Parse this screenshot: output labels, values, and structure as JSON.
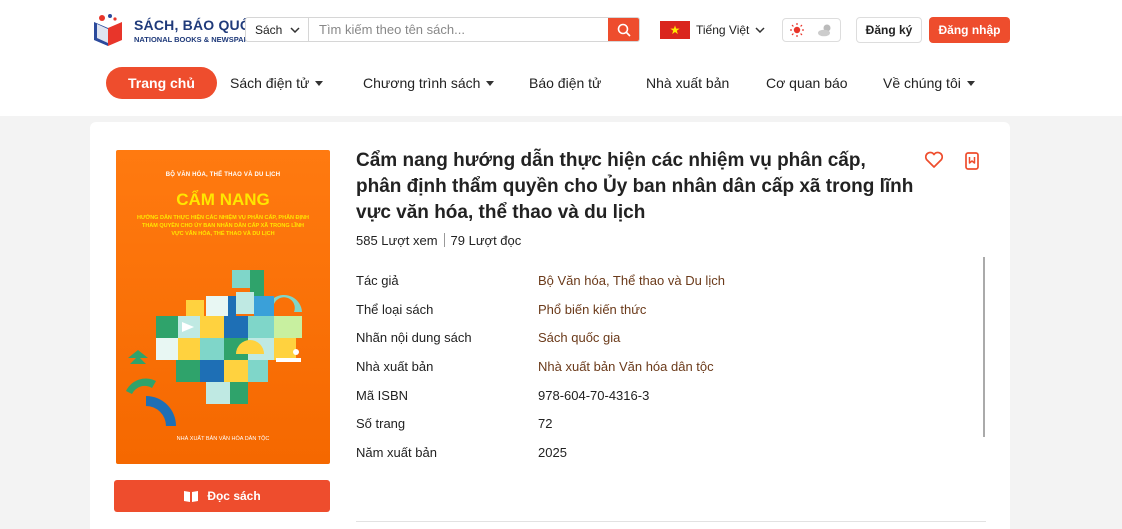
{
  "header": {
    "logo_title": "SÁCH, BÁO QUỐC GIA",
    "logo_sub": "NATIONAL BOOKS & NEWSPAPERS",
    "search_select": "Sách",
    "search_placeholder": "Tìm kiếm theo tên sách...",
    "language": "Tiếng Việt",
    "register": "Đăng ký",
    "login": "Đăng nhập",
    "accent_color": "#ee4d2d"
  },
  "nav": {
    "items": [
      {
        "label": "Trang chủ",
        "active": true
      },
      {
        "label": "Sách điện tử",
        "dropdown": true
      },
      {
        "label": "Chương trình sách",
        "dropdown": true
      },
      {
        "label": "Báo điện tử"
      },
      {
        "label": "Nhà xuất bản"
      },
      {
        "label": "Cơ quan báo"
      },
      {
        "label": "Về chúng tôi",
        "dropdown": true
      }
    ]
  },
  "cover": {
    "org": "BỘ VĂN HÓA, THỂ THAO VÀ DU LỊCH",
    "title": "CẨM NANG",
    "subtitle": "HƯỚNG DẪN THỰC HIỆN CÁC NHIỆM VỤ PHÂN CẤP, PHÂN ĐỊNH THẨM QUYỀN CHO ỦY BAN NHÂN DÂN CẤP XÃ TRONG LĨNH VỰC VĂN HÓA, THỂ THAO VÀ DU LỊCH",
    "publisher": "NHÀ XUẤT BẢN VĂN HÓA DÂN TỘC"
  },
  "read_button": "Đọc sách",
  "book": {
    "title": "Cẩm nang hướng dẫn thực hiện các nhiệm vụ phân cấp, phân định thẩm quyền cho Ủy ban nhân dân cấp xã trong lĩnh vực văn hóa, thể thao và du lịch",
    "views": "585 Lượt xem",
    "reads": "79 Lượt đọc",
    "details": [
      {
        "label": "Tác giả",
        "value": "Bộ Văn hóa, Thể thao và Du lịch",
        "link": true
      },
      {
        "label": "Thể loại sách",
        "value": "Phổ biến kiến thức",
        "link": true
      },
      {
        "label": "Nhãn nội dung sách",
        "value": "Sách quốc gia",
        "link": true
      },
      {
        "label": "Nhà xuất bản",
        "value": "Nhà xuất bản Văn hóa dân tộc",
        "link": true
      },
      {
        "label": "Mã ISBN",
        "value": "978-604-70-4316-3",
        "link": false
      },
      {
        "label": "Số trang",
        "value": "72",
        "link": false
      },
      {
        "label": "Năm xuất bản",
        "value": "2025",
        "link": false
      }
    ]
  }
}
